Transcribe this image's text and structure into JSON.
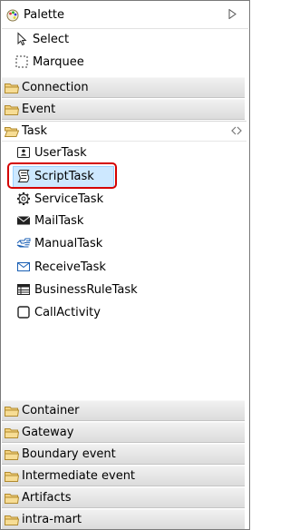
{
  "palette": {
    "title": "Palette"
  },
  "tools": [
    {
      "label": "Select",
      "icon": "select-arrow-icon"
    },
    {
      "label": "Marquee",
      "icon": "marquee-icon"
    }
  ],
  "drawers_top": [
    {
      "label": "Connection",
      "icon": "folder-icon"
    },
    {
      "label": "Event",
      "icon": "folder-icon"
    },
    {
      "label": "Task",
      "icon": "folder-open-icon"
    }
  ],
  "task_items": [
    {
      "label": "UserTask",
      "icon": "user-task-icon"
    },
    {
      "label": "ScriptTask",
      "icon": "script-task-icon",
      "selected": true
    },
    {
      "label": "ServiceTask",
      "icon": "service-task-icon"
    },
    {
      "label": "MailTask",
      "icon": "mail-task-icon"
    },
    {
      "label": "ManualTask",
      "icon": "manual-task-icon"
    },
    {
      "label": "ReceiveTask",
      "icon": "receive-task-icon"
    },
    {
      "label": "BusinessRuleTask",
      "icon": "business-rule-task-icon"
    },
    {
      "label": "CallActivity",
      "icon": "call-activity-icon"
    }
  ],
  "drawers_bottom": [
    {
      "label": "Container"
    },
    {
      "label": "Gateway"
    },
    {
      "label": "Boundary event"
    },
    {
      "label": "Intermediate event"
    },
    {
      "label": "Artifacts"
    },
    {
      "label": "intra-mart"
    }
  ],
  "colors": {
    "selection_fill": "#cde8ff",
    "highlight_ring": "#d40000",
    "folder": "#e8c36a"
  }
}
